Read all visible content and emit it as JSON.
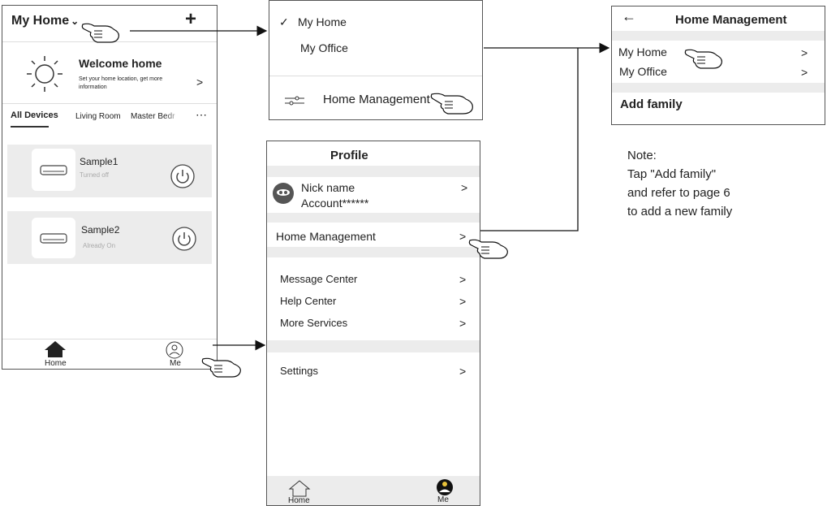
{
  "home_screen": {
    "title": "My Home",
    "welcome_title": "Welcome home",
    "welcome_sub_1": "Set your home location, get more",
    "welcome_sub_2": "information",
    "welcome_chevron": ">",
    "tabs": [
      "All Devices",
      "Living Room",
      "Master Bedroom"
    ],
    "devices": [
      {
        "name": "Sample1",
        "status": "Turned off"
      },
      {
        "name": "Sample2",
        "status": "Already On"
      }
    ],
    "nav": {
      "home": "Home",
      "me": "Me"
    }
  },
  "home_dropdown": {
    "items": [
      "My Home",
      "My  Office"
    ],
    "check": "✓",
    "management": "Home Management"
  },
  "home_management": {
    "back": "←",
    "title": "Home Management",
    "homes": [
      "My Home",
      "My  Office"
    ],
    "chevron": ">",
    "add_family": "Add family"
  },
  "profile": {
    "title": "Profile",
    "nickname": "Nick name",
    "account": "Account******",
    "home_management": "Home Management",
    "menu": [
      "Message Center",
      "Help Center",
      "More Services"
    ],
    "settings": "Settings",
    "chevron": ">",
    "nav": {
      "home": "Home",
      "me": "Me"
    }
  },
  "note": {
    "line1": "Note:",
    "line2": "Tap \"Add family\"",
    "line3": "and refer to page 6",
    "line4": "to add a new family"
  }
}
